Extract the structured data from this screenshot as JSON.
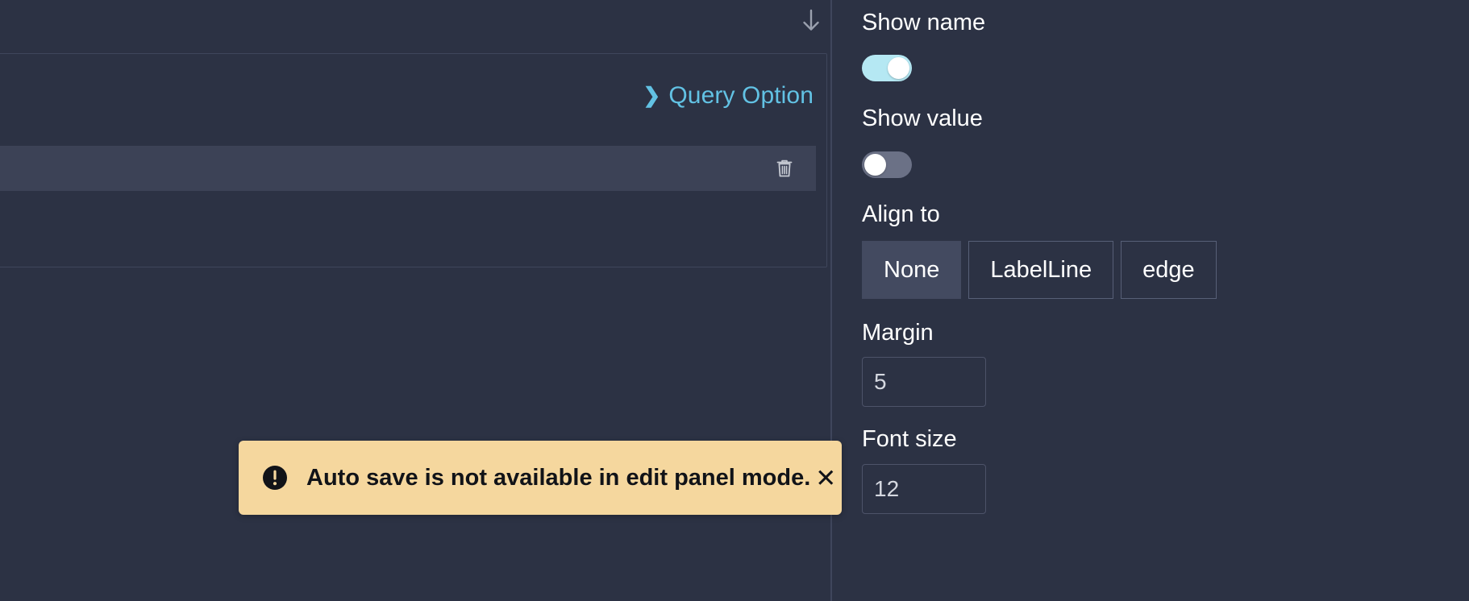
{
  "theme": {
    "background": "#2c3244",
    "panel_border": "#3f465c",
    "row_background": "#3c4256",
    "link_accent": "#62c2e4",
    "toggle_on": "#b5e8f3",
    "toggle_off": "#6b7186",
    "toast_background": "#f5d79e",
    "toast_text": "#111318",
    "segment_selected_background": "#434a60"
  },
  "left_panel": {
    "collapse_icon": "arrow-down-icon",
    "query_option": {
      "chevron": "❯",
      "label": "Query Option"
    },
    "query_row": {
      "delete_icon": "trash-icon"
    }
  },
  "sidebar": {
    "options": [
      {
        "label": "Show name",
        "type": "toggle",
        "value": "on"
      },
      {
        "label": "Show value",
        "type": "toggle",
        "value": "off"
      },
      {
        "label": "Align to",
        "type": "segmented",
        "selected": "None",
        "choices": [
          "None",
          "LabelLine",
          "edge"
        ]
      },
      {
        "label": "Margin",
        "type": "number",
        "value": "5"
      },
      {
        "label": "Font size",
        "type": "number",
        "value": "12"
      }
    ],
    "align_choices": {
      "none": "None",
      "labelline": "LabelLine",
      "edge": "edge"
    },
    "labels": {
      "show_name": "Show name",
      "show_value": "Show value",
      "align_to": "Align to",
      "margin": "Margin",
      "font_size": "Font size"
    },
    "values": {
      "margin": "5",
      "font_size": "12"
    }
  },
  "toast": {
    "icon": "alert-circle-icon",
    "message": "Auto save is not available in edit panel mode.",
    "close_label": "✕"
  }
}
